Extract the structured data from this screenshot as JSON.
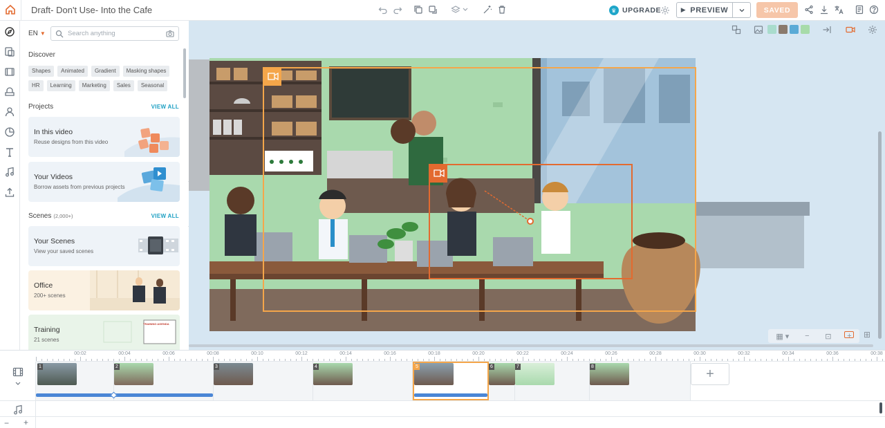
{
  "app": {
    "title": "Draft- Don't Use- Into the Cafe",
    "upgrade_label": "UPGRADE",
    "preview_label": "PREVIEW",
    "saved_label": "SAVED",
    "brand_color": "#e36a2f",
    "accent_color": "#1ea0c3"
  },
  "toolbar_icons": [
    "undo-icon",
    "redo-icon",
    "duplicate-icon",
    "paste-icon",
    "layers-icon",
    "magic-icon",
    "trash-icon"
  ],
  "panel": {
    "language": "EN",
    "search_placeholder": "Search anything",
    "discover_title": "Discover",
    "tags": [
      "Shapes",
      "Animated",
      "Gradient",
      "Masking shapes",
      "HR",
      "Learning",
      "Marketing",
      "Sales",
      "Seasonal"
    ],
    "projects_title": "Projects",
    "projects_view_all": "VIEW ALL",
    "project_cards": [
      {
        "title": "In this video",
        "subtitle": "Reuse designs from this video"
      },
      {
        "title": "Your Videos",
        "subtitle": "Borrow assets from previous projects"
      }
    ],
    "scenes_title": "Scenes",
    "scenes_count": "(2,000+)",
    "scenes_view_all": "VIEW ALL",
    "scene_cards": [
      {
        "title": "Your Scenes",
        "subtitle": "View your saved scenes"
      },
      {
        "title": "Office",
        "subtitle": "200+ scenes"
      },
      {
        "title": "Training",
        "subtitle": "21 scenes"
      }
    ],
    "training_board_text": "TRAINING AGENDA"
  },
  "stage": {
    "swatches": [
      "#a9dccd",
      "#8a7a6d",
      "#5aaad6",
      "#a7dba9"
    ]
  },
  "timeline": {
    "ticks": [
      "00:02",
      "00:04",
      "00:06",
      "00:08",
      "00:10",
      "00:12",
      "00:14",
      "00:16",
      "00:18",
      "00:20",
      "00:22",
      "00:24",
      "00:26",
      "00:28",
      "00:30",
      "00:32",
      "00:34",
      "00:36",
      "00:38"
    ],
    "scenes": [
      "1",
      "2",
      "3",
      "4",
      "5",
      "6",
      "7",
      "8"
    ],
    "add_scene_label": "+"
  }
}
